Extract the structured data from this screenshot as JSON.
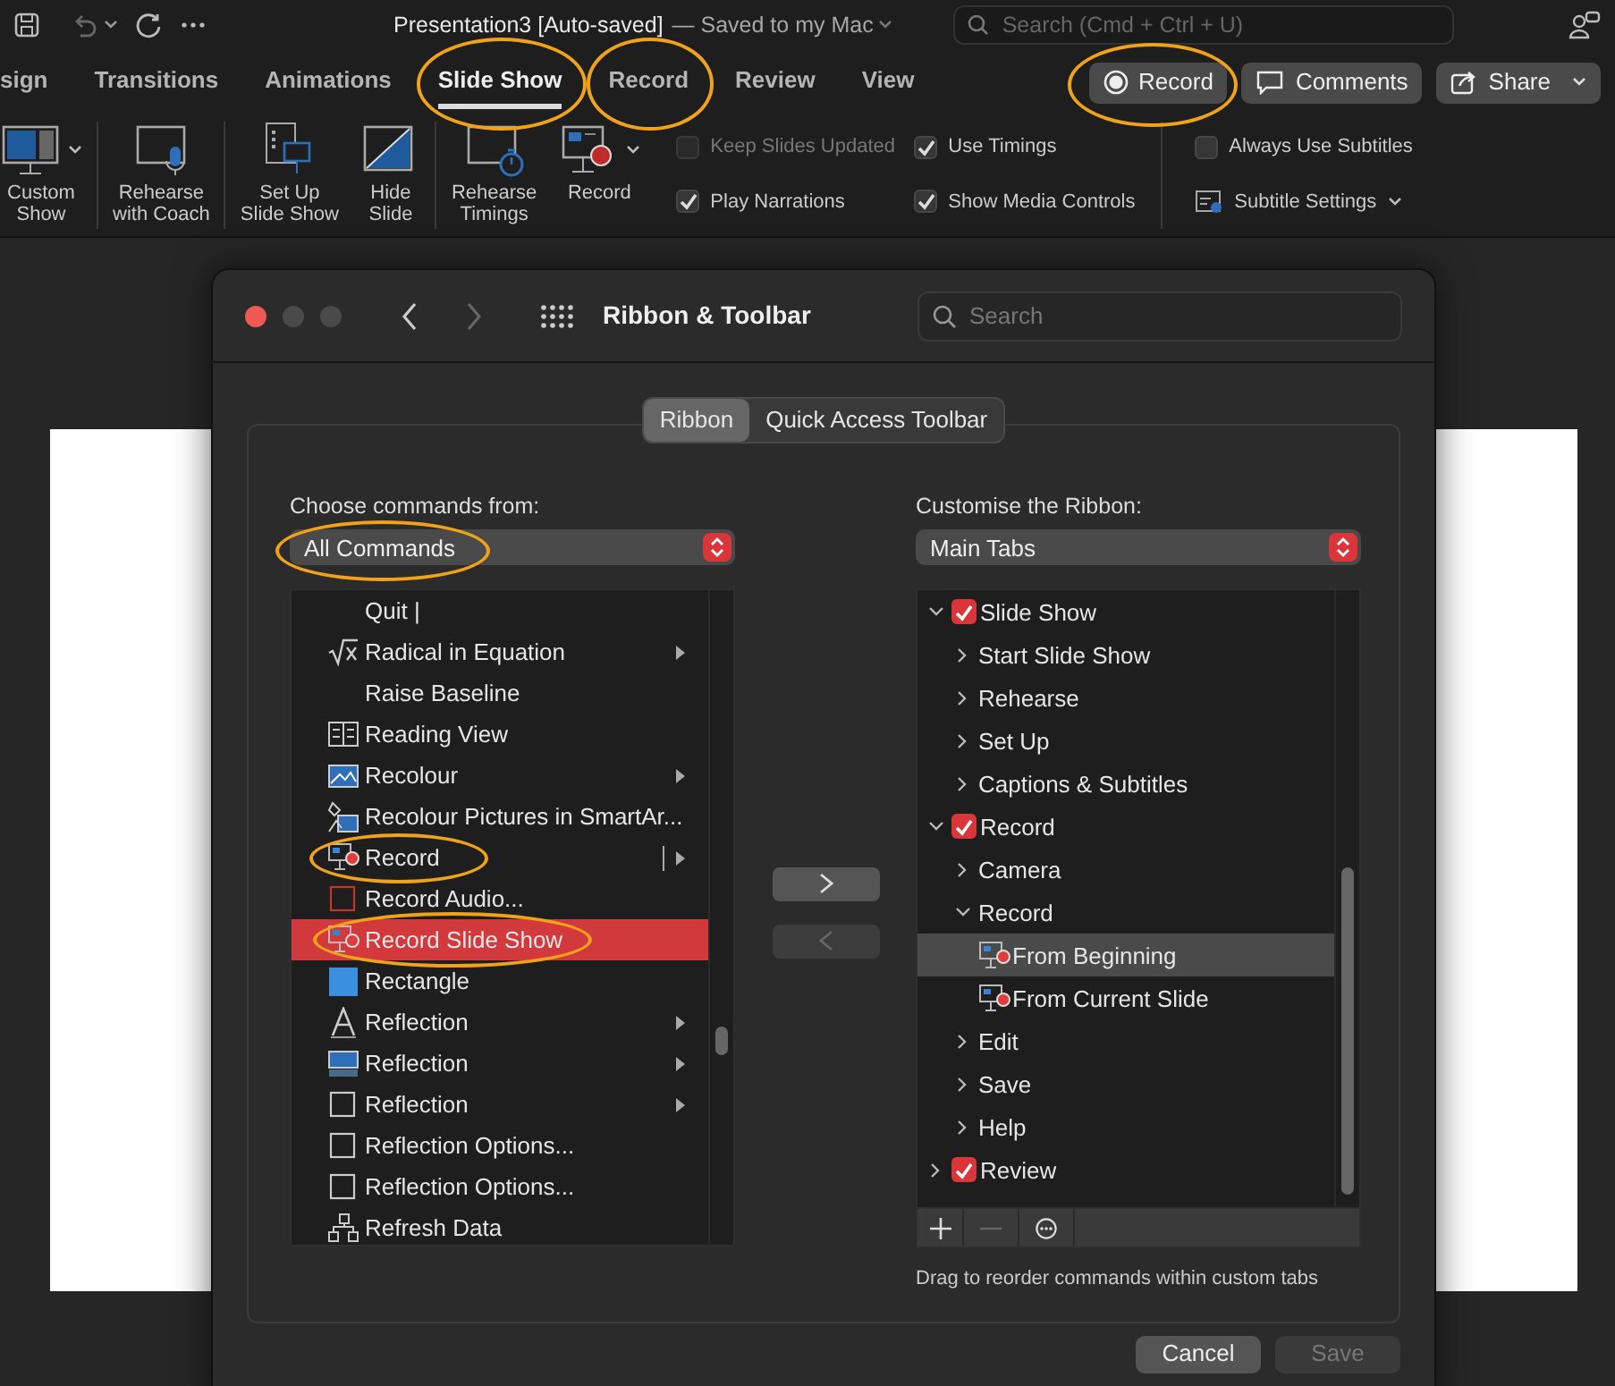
{
  "app": {
    "title": "Presentation3 [Auto-saved]",
    "save_status": "— Saved to my Mac",
    "search_placeholder": "Search (Cmd + Ctrl + U)"
  },
  "tabs": [
    {
      "label": "sign",
      "selected": false,
      "circled": false
    },
    {
      "label": "Transitions",
      "selected": false,
      "circled": false
    },
    {
      "label": "Animations",
      "selected": false,
      "circled": false
    },
    {
      "label": "Slide Show",
      "selected": true,
      "circled": true
    },
    {
      "label": "Record",
      "selected": false,
      "circled": true
    },
    {
      "label": "Review",
      "selected": false,
      "circled": false
    },
    {
      "label": "View",
      "selected": false,
      "circled": false
    }
  ],
  "header_buttons": [
    {
      "label": "Record",
      "circled": true
    },
    {
      "label": "Comments",
      "circled": false
    },
    {
      "label": "Share",
      "circled": false
    }
  ],
  "ribbon": {
    "buttons": [
      {
        "label": "Custom\nShow",
        "dropdown": true
      },
      {
        "label": "Rehearse\nwith Coach",
        "dropdown": false
      },
      {
        "label": "Set Up\nSlide Show",
        "dropdown": false
      },
      {
        "label": "Hide\nSlide",
        "dropdown": false
      },
      {
        "label": "Rehearse\nTimings",
        "dropdown": false
      },
      {
        "label": "Record",
        "dropdown": true
      }
    ],
    "options": [
      {
        "label": "Keep Slides Updated",
        "checked": false,
        "disabled": true
      },
      {
        "label": "Use Timings",
        "checked": true,
        "disabled": false
      },
      {
        "label": "Play Narrations",
        "checked": true,
        "disabled": false
      },
      {
        "label": "Show Media Controls",
        "checked": true,
        "disabled": false
      }
    ],
    "subtitles": [
      {
        "kind": "checkbox",
        "label": "Always Use Subtitles",
        "checked": false
      },
      {
        "kind": "menu",
        "label": "Subtitle Settings"
      }
    ]
  },
  "dialog": {
    "title": "Ribbon & Toolbar",
    "search_placeholder": "Search",
    "segments": [
      {
        "label": "Ribbon",
        "selected": true
      },
      {
        "label": "Quick Access Toolbar",
        "selected": false
      }
    ],
    "left": {
      "label": "Choose commands from:",
      "dropdown": {
        "value": "All Commands",
        "circled": true
      },
      "items": [
        {
          "label": "Quit |",
          "submenu": false,
          "split": false,
          "selected": false,
          "circled": false
        },
        {
          "label": "Radical in Equation",
          "submenu": true,
          "split": false,
          "selected": false,
          "circled": false
        },
        {
          "label": "Raise Baseline",
          "submenu": false,
          "split": false,
          "selected": false,
          "circled": false
        },
        {
          "label": "Reading View",
          "submenu": false,
          "split": false,
          "selected": false,
          "circled": false
        },
        {
          "label": "Recolour",
          "submenu": true,
          "split": false,
          "selected": false,
          "circled": false
        },
        {
          "label": "Recolour Pictures in SmartAr...",
          "submenu": false,
          "split": false,
          "selected": false,
          "circled": false
        },
        {
          "label": "Record",
          "submenu": true,
          "split": true,
          "selected": false,
          "circled": true
        },
        {
          "label": "Record Audio...",
          "submenu": false,
          "split": false,
          "selected": false,
          "circled": false
        },
        {
          "label": "Record Slide Show",
          "submenu": false,
          "split": false,
          "selected": true,
          "circled": true
        },
        {
          "label": "Rectangle",
          "submenu": false,
          "split": false,
          "selected": false,
          "circled": false
        },
        {
          "label": "Reflection",
          "submenu": true,
          "split": false,
          "selected": false,
          "circled": false
        },
        {
          "label": "Reflection",
          "submenu": true,
          "split": false,
          "selected": false,
          "circled": false
        },
        {
          "label": "Reflection",
          "submenu": true,
          "split": false,
          "selected": false,
          "circled": false
        },
        {
          "label": "Reflection Options...",
          "submenu": false,
          "split": false,
          "selected": false,
          "circled": false
        },
        {
          "label": "Reflection Options...",
          "submenu": false,
          "split": false,
          "selected": false,
          "circled": false
        },
        {
          "label": "Refresh Data",
          "submenu": false,
          "split": false,
          "selected": false,
          "circled": false
        }
      ]
    },
    "move_buttons": [
      {
        "disabled": false
      },
      {
        "disabled": true
      }
    ],
    "right": {
      "label": "Customise the Ribbon:",
      "dropdown": {
        "value": "Main Tabs",
        "circled": false
      },
      "tree": [
        {
          "kind": "tab",
          "label": "Slide Show",
          "checked": true,
          "expanded": true,
          "selected": false,
          "children": [
            {
              "kind": "group",
              "label": "Start Slide Show",
              "expanded": false,
              "selected": false
            },
            {
              "kind": "group",
              "label": "Rehearse",
              "expanded": false,
              "selected": false
            },
            {
              "kind": "group",
              "label": "Set Up",
              "expanded": false,
              "selected": false
            },
            {
              "kind": "group",
              "label": "Captions & Subtitles",
              "expanded": false,
              "selected": false
            }
          ]
        },
        {
          "kind": "tab",
          "label": "Record",
          "checked": true,
          "expanded": true,
          "selected": false,
          "children": [
            {
              "kind": "group",
              "label": "Camera",
              "expanded": false,
              "selected": false
            },
            {
              "kind": "group",
              "label": "Record",
              "expanded": true,
              "selected": false,
              "children": [
                {
                  "kind": "command",
                  "label": "From Beginning",
                  "selected": true
                },
                {
                  "kind": "command",
                  "label": "From Current Slide",
                  "selected": false
                }
              ]
            },
            {
              "kind": "group",
              "label": "Edit",
              "expanded": false,
              "selected": false
            },
            {
              "kind": "group",
              "label": "Save",
              "expanded": false,
              "selected": false
            },
            {
              "kind": "group",
              "label": "Help",
              "expanded": false,
              "selected": false
            }
          ]
        },
        {
          "kind": "tab",
          "label": "Review",
          "checked": true,
          "expanded": false,
          "selected": false
        }
      ],
      "tools": [
        {
          "disabled": false
        },
        {
          "disabled": true
        },
        {
          "disabled": false
        }
      ],
      "caption": "Drag to reorder commands within custom tabs"
    },
    "buttons": [
      {
        "label": "Cancel",
        "disabled": false
      },
      {
        "label": "Save",
        "disabled": true
      }
    ]
  }
}
